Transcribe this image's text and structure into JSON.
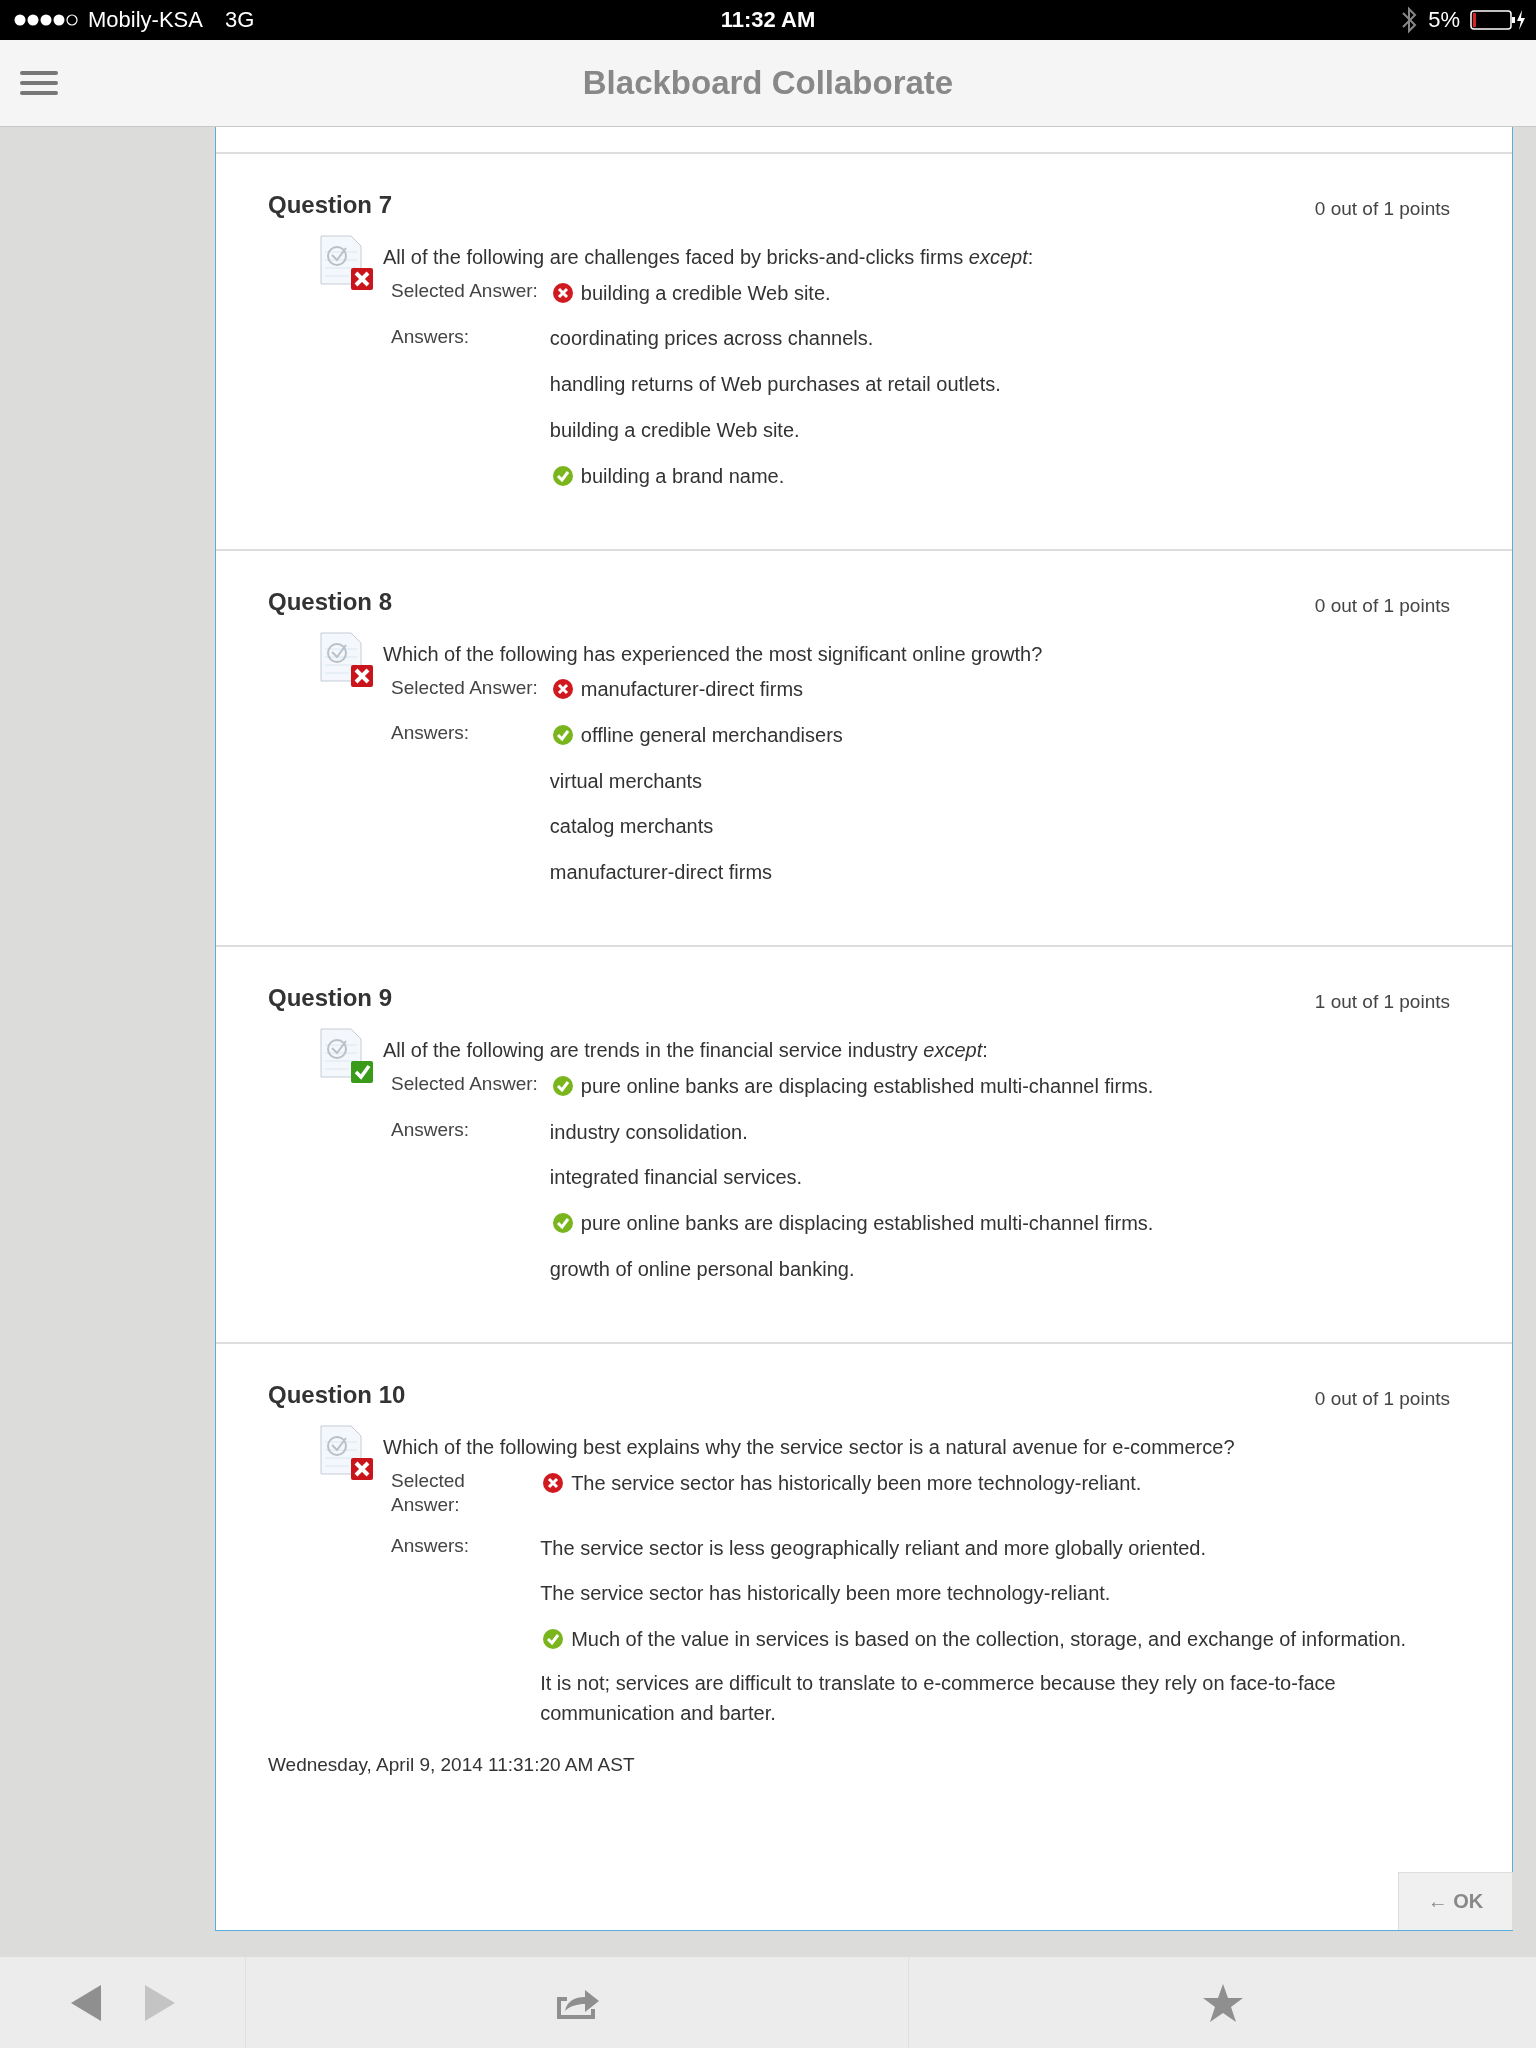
{
  "status_bar": {
    "carrier": "Mobily-KSA",
    "network": "3G",
    "time": "11:32 AM",
    "battery": "5%"
  },
  "nav_bar": {
    "title": "Blackboard Collaborate"
  },
  "questions": [
    {
      "title": "Question 7",
      "points": "0 out of 1 points",
      "correct": false,
      "text": "All of the following are challenges faced by bricks-and-clicks firms *except*:",
      "selected_label": "Selected Answer:",
      "selected_answer": {
        "text": "building a credible Web site.",
        "correct": false
      },
      "answers_label": "Answers:",
      "answers": [
        {
          "text": "coordinating prices across channels.",
          "correct": false
        },
        {
          "text": "handling returns of Web purchases at retail outlets.",
          "correct": false
        },
        {
          "text": "building a credible Web site.",
          "correct": false
        },
        {
          "text": "building a brand name.",
          "correct": true
        }
      ]
    },
    {
      "title": "Question 8",
      "points": "0 out of 1 points",
      "correct": false,
      "text": "Which of the following has experienced the most significant online growth?",
      "selected_label": "Selected Answer:",
      "selected_answer": {
        "text": "manufacturer-direct firms",
        "correct": false
      },
      "answers_label": "Answers:",
      "answers": [
        {
          "text": "offline general merchandisers",
          "correct": true
        },
        {
          "text": "virtual merchants",
          "correct": false
        },
        {
          "text": "catalog merchants",
          "correct": false
        },
        {
          "text": "manufacturer-direct firms",
          "correct": false
        }
      ]
    },
    {
      "title": "Question 9",
      "points": "1 out of 1 points",
      "correct": true,
      "text": "All of the following are trends in the financial service industry *except*:",
      "selected_label": "Selected Answer:",
      "selected_answer": {
        "text": "pure online banks are displacing established multi-channel firms.",
        "correct": true
      },
      "answers_label": "Answers:",
      "answers": [
        {
          "text": "industry consolidation.",
          "correct": false
        },
        {
          "text": "integrated financial services.",
          "correct": false
        },
        {
          "text": "pure online banks are displacing established multi-channel firms.",
          "correct": true
        },
        {
          "text": "growth of online personal banking.",
          "correct": false
        }
      ]
    },
    {
      "title": "Question 10",
      "points": "0 out of 1 points",
      "correct": false,
      "text": "Which of the following best explains why the service sector is a natural avenue for e-commerce?",
      "selected_label": "Selected Answer:",
      "selected_answer": {
        "text": "The service sector has historically been more technology-reliant.",
        "correct": false
      },
      "answers_label": "Answers:",
      "answers": [
        {
          "text": "The service sector is less geographically reliant and more globally oriented.",
          "correct": false
        },
        {
          "text": "The service sector has historically been more technology-reliant.",
          "correct": false
        },
        {
          "text": "Much of the value in services is based on the collection, storage, and exchange of information.",
          "correct": true
        },
        {
          "text": "It is not; services are difficult to translate to e-commerce because they rely on face-to-face communication and barter.",
          "correct": false
        }
      ]
    }
  ],
  "footer_date": "Wednesday, April 9, 2014 11:31:20 AM AST",
  "ok_button": "← OK",
  "toolbar": {
    "back_disabled": false,
    "forward_disabled": true
  }
}
